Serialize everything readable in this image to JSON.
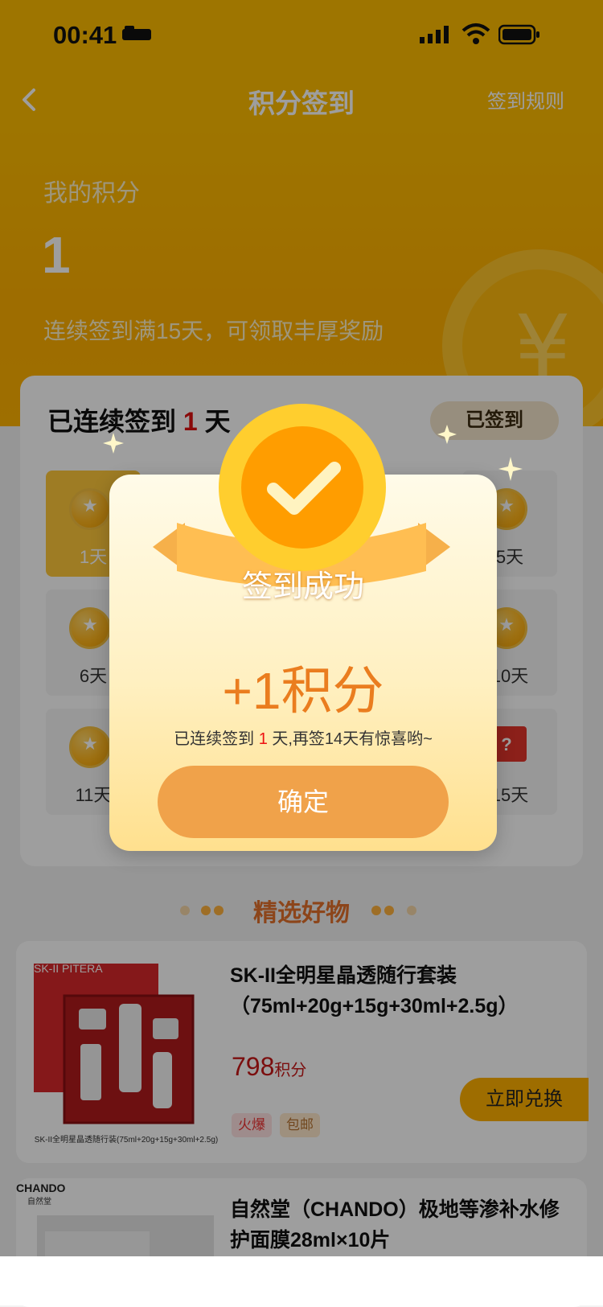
{
  "status_bar": {
    "time": "00:41"
  },
  "header": {
    "title": "积分签到",
    "rules_link": "签到规则"
  },
  "hero": {
    "label": "我的积分",
    "points": "1",
    "note": "连续签到满15天，可领取丰厚奖励"
  },
  "sign_panel": {
    "title_prefix": "已连续签到",
    "streak_days": "1",
    "title_suffix": "天",
    "signed_label": "已签到",
    "days": [
      {
        "label": "1天",
        "signed": true
      },
      {
        "label": "5天",
        "signed": false
      },
      {
        "label": "6天",
        "signed": false
      },
      {
        "label": "10天",
        "signed": false
      },
      {
        "label": "11天",
        "signed": false
      },
      {
        "label": "15天",
        "signed": false
      }
    ]
  },
  "section": {
    "title": "精选好物"
  },
  "products": [
    {
      "name": "SK-II全明星晶透随行套装（75ml+20g+15g+30ml+2.5g）",
      "price": "798",
      "unit": "积分",
      "tags": [
        "火爆",
        "包邮"
      ],
      "redeem_label": "立即兑换",
      "image_caption": "SK-II全明星晶透随行装(75ml+20g+15g+30ml+2.5g)",
      "brand_text": "SK-II PITERA"
    },
    {
      "name": "自然堂（CHANDO）极地等渗补水修护面膜28ml×10片",
      "brand_text": "CHANDO",
      "brand_sub": "自然堂"
    }
  ],
  "modal": {
    "title": "签到成功",
    "points_gain": "+1积分",
    "streak_prefix": "已连续签到",
    "streak_days": "1",
    "streak_suffix": "天,再签14天有惊喜哟~",
    "confirm_label": "确定"
  },
  "colors": {
    "brand_yellow": "#ffbd00",
    "accent_orange": "#ea7d1f",
    "price_red": "#c71818",
    "button_orange": "#f0a24a"
  }
}
